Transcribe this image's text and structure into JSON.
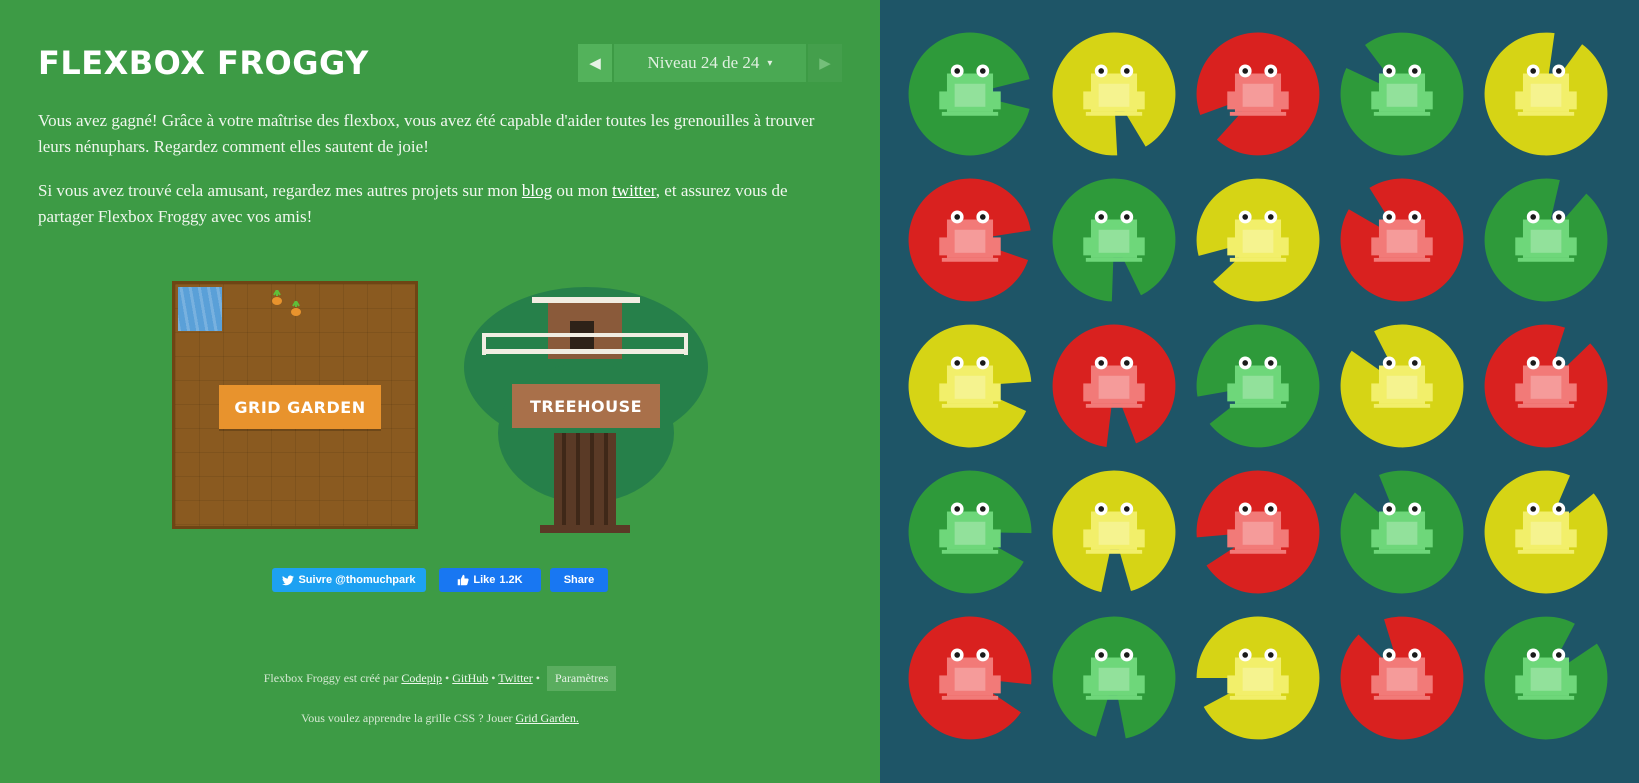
{
  "header": {
    "title": "FLEXBOX FROGGY",
    "level_label": "Niveau 24 de 24",
    "prev_arrow": "◀",
    "next_arrow": "▶",
    "caret": "▾"
  },
  "content": {
    "p1": "Vous avez gagné! Grâce à votre maîtrise des flexbox, vous avez été capable d'aider toutes les grenouilles à trouver leurs nénuphars. Regardez comment elles sautent de joie!",
    "p2_before": "Si vous avez trouvé cela amusant, regardez mes autres projets sur mon ",
    "p2_link1": "blog",
    "p2_middle": " ou mon ",
    "p2_link2": "twitter",
    "p2_after": ", et assurez vous de partager Flexbox Froggy avec vos amis!"
  },
  "promos": {
    "grid_garden": "GRID GARDEN",
    "treehouse": "TREEHOUSE"
  },
  "social": {
    "twitter_follow": "Suivre @thomuchpark",
    "like_label": "Like",
    "like_count": "1.2K",
    "share_label": "Share"
  },
  "footer": {
    "credit_prefix": "Flexbox Froggy est créé par",
    "link_codepip": "Codepip",
    "link_github": "GitHub",
    "link_twitter": "Twitter",
    "sep": "•",
    "settings_button": "Paramètres",
    "grid_prefix": "Vous voulez apprendre la grille CSS ? Jouer",
    "grid_link": "Grid Garden."
  },
  "pond": {
    "colors": {
      "green": "#2e9a3a",
      "yellow": "#d6d415",
      "red": "#d9211f",
      "green_frog": "#6ed77a",
      "yellow_frog": "#f2ef6a",
      "red_frog": "#f27a78"
    },
    "pads": [
      "green",
      "yellow",
      "red",
      "green",
      "yellow",
      "red",
      "green",
      "yellow",
      "red",
      "green",
      "yellow",
      "red",
      "green",
      "yellow",
      "red",
      "green",
      "yellow",
      "red",
      "green",
      "yellow",
      "red",
      "green",
      "yellow",
      "red",
      "green"
    ]
  }
}
